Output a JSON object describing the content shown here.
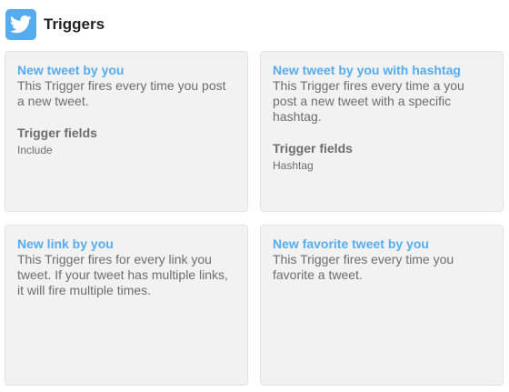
{
  "header": {
    "title": "Triggers",
    "icon": "twitter-bird-icon",
    "brand_color": "#55acee"
  },
  "triggers": [
    {
      "title": "New tweet by you",
      "description": "This Trigger fires every time you post a new tweet.",
      "fields_label": "Trigger fields",
      "fields": [
        "Include"
      ]
    },
    {
      "title": "New tweet by you with hashtag",
      "description": "This Trigger fires every time a you post a new tweet with a specific hashtag.",
      "fields_label": "Trigger fields",
      "fields": [
        "Hashtag"
      ]
    },
    {
      "title": "New link by you",
      "description": "This Trigger fires for every link you tweet. If your tweet has multiple links, it will fire multiple times."
    },
    {
      "title": "New favorite tweet by you",
      "description": "This Trigger fires every time you favorite a tweet."
    }
  ]
}
